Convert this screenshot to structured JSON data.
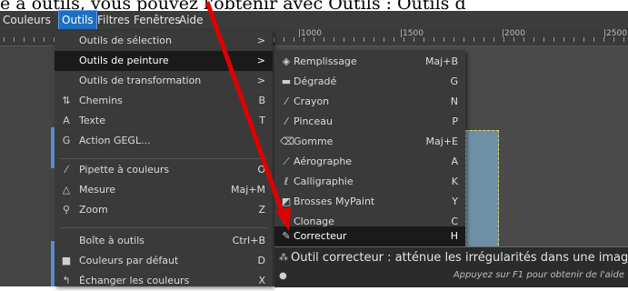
{
  "caption": "e à outils, vous pouvez l'obtenir avec Outils : Outils d",
  "menubar": [
    "Couleurs",
    "Outils",
    "Filtres",
    "Fenêtres",
    "Aide"
  ],
  "ruler_labels": [
    "|1000",
    "|1500",
    "|2000",
    "|2500"
  ],
  "outils_menu": [
    {
      "label": "Outils de sélection",
      "shortcut": ">",
      "icon": ""
    },
    {
      "label": "Outils de peinture",
      "shortcut": ">",
      "icon": ""
    },
    {
      "label": "Outils de transformation",
      "shortcut": ">",
      "icon": ""
    },
    {
      "label": "Chemins",
      "shortcut": "B",
      "icon": "⇅"
    },
    {
      "label": "Texte",
      "shortcut": "T",
      "icon": "A"
    },
    {
      "label": "Action GEGL...",
      "shortcut": "",
      "icon": "G"
    },
    {
      "label": "Pipette à couleurs",
      "shortcut": "O",
      "icon": "⁄"
    },
    {
      "label": "Mesure",
      "shortcut": "Maj+M",
      "icon": "△"
    },
    {
      "label": "Zoom",
      "shortcut": "Z",
      "icon": "⚲"
    },
    {
      "label": "Boîte à outils",
      "shortcut": "Ctrl+B",
      "icon": ""
    },
    {
      "label": "Couleurs par défaut",
      "shortcut": "D",
      "icon": "■"
    },
    {
      "label": "Échanger les couleurs",
      "shortcut": "X",
      "icon": "↰"
    }
  ],
  "peinture_menu": [
    {
      "label": "Remplissage",
      "shortcut": "Maj+B",
      "icon": "◈"
    },
    {
      "label": "Dégradé",
      "shortcut": "G",
      "icon": "▬"
    },
    {
      "label": "Crayon",
      "shortcut": "N",
      "icon": "⁄"
    },
    {
      "label": "Pinceau",
      "shortcut": "P",
      "icon": "⁄"
    },
    {
      "label": "Gomme",
      "shortcut": "Maj+E",
      "icon": "⌫"
    },
    {
      "label": "Aérographe",
      "shortcut": "A",
      "icon": "⟋"
    },
    {
      "label": "Calligraphie",
      "shortcut": "K",
      "icon": "ℓ"
    },
    {
      "label": "Brosses MyPaint",
      "shortcut": "Y",
      "icon": "◩"
    },
    {
      "label": "Clonage",
      "shortcut": "C",
      "icon": "⊙"
    },
    {
      "label": "Correcteur",
      "shortcut": "H",
      "icon": "✎"
    }
  ],
  "tooltip": {
    "main": "Outil correcteur : atténue les irrégularités dans une image",
    "help": "Appuyez sur F1 pour obtenir de l'aide"
  },
  "colors": {
    "highlight": "#1a1a1a",
    "menubar_active": "#1f6fc0",
    "arrow": "#e00000"
  }
}
